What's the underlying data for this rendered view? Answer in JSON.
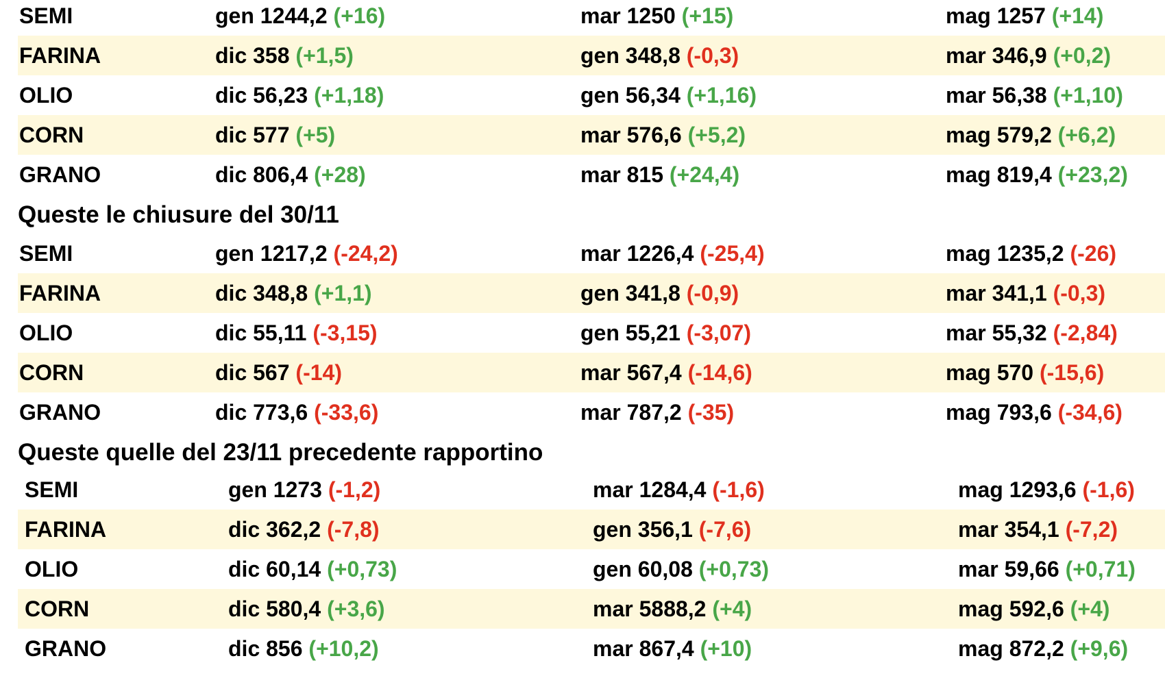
{
  "colors": {
    "positive": "#48a648",
    "negative": "#e0301e",
    "stripe": "#fef8dc"
  },
  "sections": [
    {
      "heading": "",
      "rows": [
        {
          "name": "SEMI",
          "cells": [
            {
              "text": "gen 1244,2",
              "change": "(+16)",
              "dir": "pos"
            },
            {
              "text": "mar 1250",
              "change": "(+15)",
              "dir": "pos"
            },
            {
              "text": "mag 1257",
              "change": "(+14)",
              "dir": "pos"
            }
          ]
        },
        {
          "name": "FARINA",
          "cells": [
            {
              "text": "dic 358",
              "change": "(+1,5)",
              "dir": "pos"
            },
            {
              "text": "gen 348,8",
              "change": "(-0,3)",
              "dir": "neg"
            },
            {
              "text": "mar 346,9",
              "change": "(+0,2)",
              "dir": "pos"
            }
          ]
        },
        {
          "name": "OLIO",
          "cells": [
            {
              "text": "dic 56,23",
              "change": "(+1,18)",
              "dir": "pos"
            },
            {
              "text": "gen 56,34",
              "change": "(+1,16)",
              "dir": "pos"
            },
            {
              "text": "mar 56,38",
              "change": "(+1,10)",
              "dir": "pos"
            }
          ]
        },
        {
          "name": "CORN",
          "cells": [
            {
              "text": "dic 577",
              "change": "(+5)",
              "dir": "pos"
            },
            {
              "text": "mar 576,6",
              "change": "(+5,2)",
              "dir": "pos"
            },
            {
              "text": "mag 579,2",
              "change": "(+6,2)",
              "dir": "pos"
            }
          ]
        },
        {
          "name": "GRANO",
          "cells": [
            {
              "text": "dic 806,4",
              "change": "(+28)",
              "dir": "pos"
            },
            {
              "text": "mar 815",
              "change": "(+24,4)",
              "dir": "pos"
            },
            {
              "text": "mag 819,4",
              "change": "(+23,2)",
              "dir": "pos"
            }
          ]
        }
      ]
    },
    {
      "heading": "Queste le chiusure del 30/11",
      "rows": [
        {
          "name": "SEMI",
          "cells": [
            {
              "text": "gen 1217,2",
              "change": "(-24,2)",
              "dir": "neg"
            },
            {
              "text": "mar 1226,4",
              "change": "(-25,4)",
              "dir": "neg"
            },
            {
              "text": "mag 1235,2",
              "change": "(-26)",
              "dir": "neg"
            }
          ]
        },
        {
          "name": "FARINA",
          "cells": [
            {
              "text": "dic 348,8",
              "change": "(+1,1)",
              "dir": "pos"
            },
            {
              "text": "gen 341,8",
              "change": "(-0,9)",
              "dir": "neg"
            },
            {
              "text": "mar 341,1",
              "change": "(-0,3)",
              "dir": "neg"
            }
          ]
        },
        {
          "name": "OLIO",
          "cells": [
            {
              "text": "dic 55,11",
              "change": "(-3,15)",
              "dir": "neg"
            },
            {
              "text": "gen 55,21",
              "change": "(-3,07)",
              "dir": "neg"
            },
            {
              "text": "mar 55,32",
              "change": "(-2,84)",
              "dir": "neg"
            }
          ]
        },
        {
          "name": "CORN",
          "cells": [
            {
              "text": "dic 567",
              "change": "(-14)",
              "dir": "neg"
            },
            {
              "text": "mar 567,4",
              "change": "(-14,6)",
              "dir": "neg"
            },
            {
              "text": "mag 570",
              "change": "(-15,6)",
              "dir": "neg"
            }
          ]
        },
        {
          "name": "GRANO",
          "cells": [
            {
              "text": "dic 773,6",
              "change": "(-33,6)",
              "dir": "neg"
            },
            {
              "text": "mar 787,2",
              "change": "(-35)",
              "dir": "neg"
            },
            {
              "text": "mag 793,6",
              "change": "(-34,6)",
              "dir": "neg"
            }
          ]
        }
      ]
    },
    {
      "heading": "Queste quelle del 23/11 precedente rapportino",
      "rows": [
        {
          "name": "SEMI",
          "cells": [
            {
              "text": "gen 1273",
              "change": "(-1,2)",
              "dir": "neg"
            },
            {
              "text": "mar 1284,4",
              "change": "(-1,6)",
              "dir": "neg"
            },
            {
              "text": "mag 1293,6",
              "change": "(-1,6)",
              "dir": "neg"
            }
          ]
        },
        {
          "name": "FARINA",
          "cells": [
            {
              "text": "dic 362,2",
              "change": "(-7,8)",
              "dir": "neg"
            },
            {
              "text": "gen 356,1",
              "change": "(-7,6)",
              "dir": "neg"
            },
            {
              "text": "mar 354,1",
              "change": "(-7,2)",
              "dir": "neg"
            }
          ]
        },
        {
          "name": "OLIO",
          "cells": [
            {
              "text": "dic 60,14",
              "change": "(+0,73)",
              "dir": "pos"
            },
            {
              "text": "gen 60,08",
              "change": "(+0,73)",
              "dir": "pos"
            },
            {
              "text": "mar 59,66",
              "change": "(+0,71)",
              "dir": "pos"
            }
          ]
        },
        {
          "name": "CORN",
          "cells": [
            {
              "text": "dic 580,4",
              "change": "(+3,6)",
              "dir": "pos"
            },
            {
              "text": "mar 5888,2",
              "change": "(+4)",
              "dir": "pos"
            },
            {
              "text": "mag 592,6",
              "change": "(+4)",
              "dir": "pos"
            }
          ]
        },
        {
          "name": "GRANO",
          "cells": [
            {
              "text": "dic 856",
              "change": "(+10,2)",
              "dir": "pos"
            },
            {
              "text": "mar 867,4",
              "change": "(+10)",
              "dir": "pos"
            },
            {
              "text": "mag 872,2",
              "change": "(+9,6)",
              "dir": "pos"
            }
          ]
        }
      ]
    }
  ]
}
